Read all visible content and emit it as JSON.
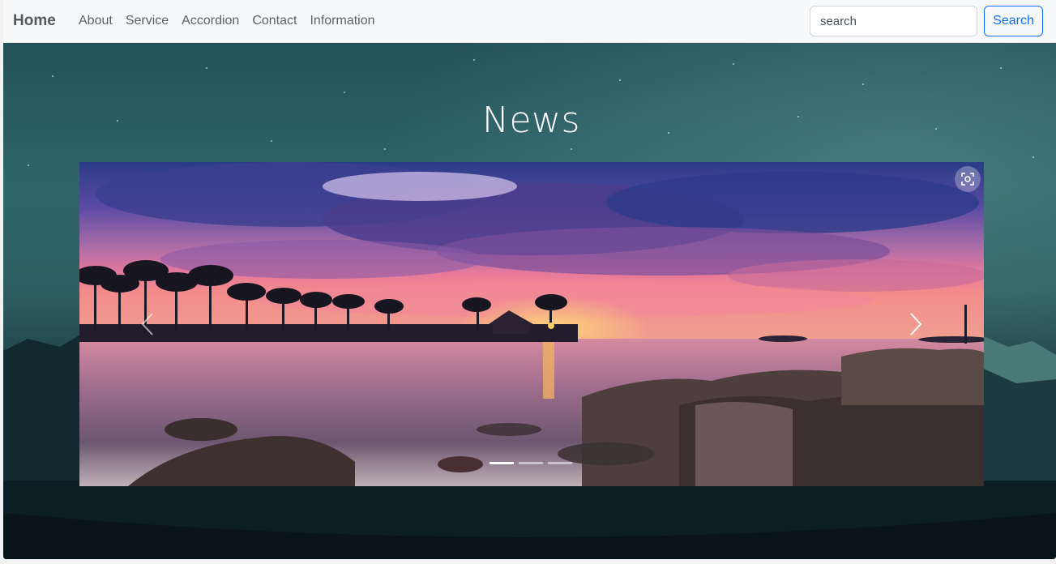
{
  "navbar": {
    "brand": "Home",
    "links": [
      {
        "label": "About"
      },
      {
        "label": "Service"
      },
      {
        "label": "Accordion"
      },
      {
        "label": "Contact"
      },
      {
        "label": "Information"
      }
    ],
    "search": {
      "placeholder": "search",
      "button_label": "Search"
    }
  },
  "hero": {
    "title": "News"
  },
  "carousel": {
    "slide_count": 3,
    "active_index": 0,
    "prev_icon": "chevron-left-icon",
    "next_icon": "chevron-right-icon",
    "overlay_icon": "visual-search-icon"
  },
  "colors": {
    "accent": "#0d6efd",
    "navbar_bg": "#f8f9fa",
    "hero_bg": "#2e5e61"
  }
}
